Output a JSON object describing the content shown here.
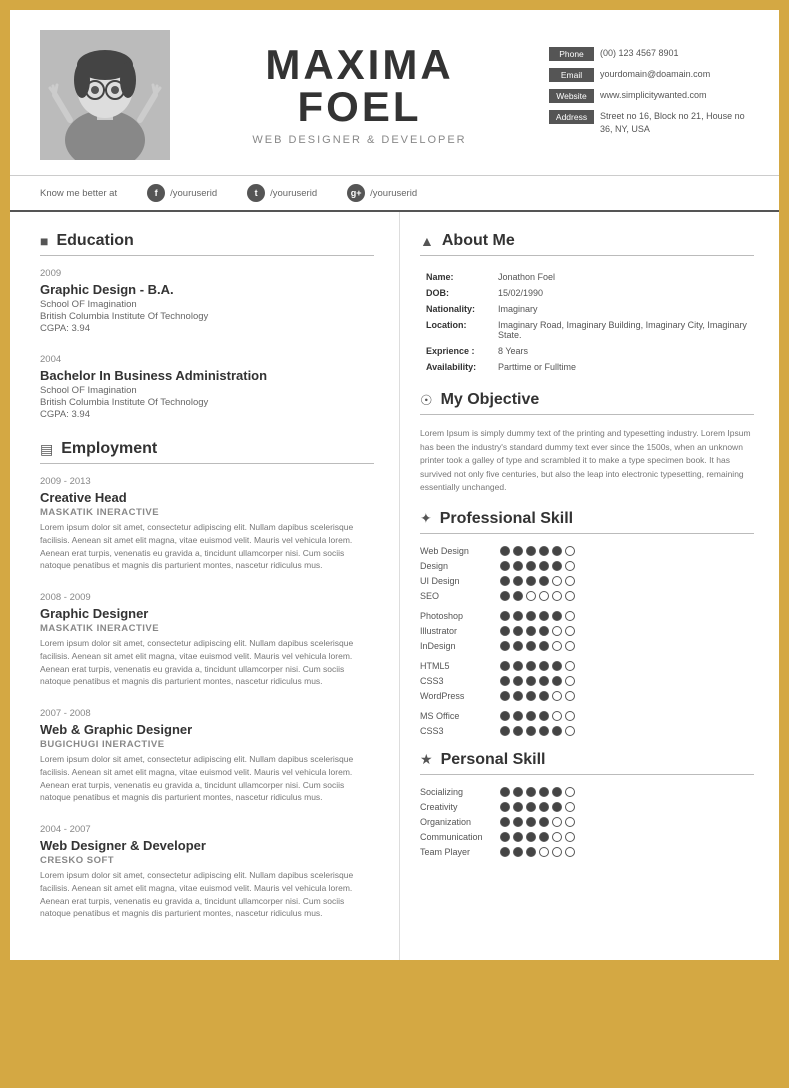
{
  "header": {
    "photo_alt": "Maxima Foel photo",
    "first_name": "MAXIMA",
    "last_name": "FOEL",
    "title": "WEB DESIGNER & DEVELOPER",
    "contact": {
      "phone_label": "Phone",
      "phone": "(00) 123 4567 8901",
      "email_label": "Email",
      "email": "yourdomain@doamain.com",
      "website_label": "Website",
      "website": "www.simplicitywanted.com",
      "address_label": "Address",
      "address": "Street no 16, Block no 21, House no 36, NY, USA"
    }
  },
  "social": {
    "know_me": "Know me better at",
    "facebook": "/youruserid",
    "twitter": "/youruserid",
    "gplus": "/youruserid"
  },
  "education": {
    "section_title": "Education",
    "items": [
      {
        "year": "2009",
        "title": "Graphic Design - B.A.",
        "school": "School OF Imagination",
        "university": "British Columbia  Institute Of Technology",
        "cgpa": "CGPA:  3.94"
      },
      {
        "year": "2004",
        "title": "Bachelor In Business Administration",
        "school": "School OF Imagination",
        "university": "British Columbia  Institute Of Technology",
        "cgpa": "CGPA:  3.94"
      }
    ]
  },
  "employment": {
    "section_title": "Employment",
    "items": [
      {
        "year": "2009 - 2013",
        "title": "Creative Head",
        "company": "MASKATIK INERACTIVE",
        "text": "Lorem ipsum dolor sit amet, consectetur adipiscing elit. Nullam dapibus scelerisque facilisis. Aenean sit amet elit magna, vitae euismod velit. Mauris vel vehicula lorem. Aenean erat turpis, venenatis eu gravida a, tincidunt ullamcorper nisi. Cum sociis natoque penatibus et magnis dis parturient montes, nascetur ridiculus mus."
      },
      {
        "year": "2008 - 2009",
        "title": "Graphic Designer",
        "company": "MASKATIK INERACTIVE",
        "text": "Lorem ipsum dolor sit amet, consectetur adipiscing elit. Nullam dapibus scelerisque facilisis. Aenean sit amet elit magna, vitae euismod velit. Mauris vel vehicula lorem. Aenean erat turpis, venenatis eu gravida a, tincidunt ullamcorper nisi. Cum sociis natoque penatibus et magnis dis parturient montes, nascetur ridiculus mus."
      },
      {
        "year": "2007 - 2008",
        "title": "Web & Graphic Designer",
        "company": "BUGICHUGI INERACTIVE",
        "text": "Lorem ipsum dolor sit amet, consectetur adipiscing elit. Nullam dapibus scelerisque facilisis. Aenean sit amet elit magna, vitae euismod velit. Mauris vel vehicula lorem. Aenean erat turpis, venenatis eu gravida a, tincidunt ullamcorper nisi. Cum sociis natoque penatibus et magnis dis parturient montes, nascetur ridiculus mus."
      },
      {
        "year": "2004 - 2007",
        "title": "Web Designer & Developer",
        "company": "CRESKO SOFT",
        "text": "Lorem ipsum dolor sit amet, consectetur adipiscing elit. Nullam dapibus scelerisque facilisis. Aenean sit amet elit magna, vitae euismod velit. Mauris vel vehicula lorem. Aenean erat turpis, venenatis eu gravida a, tincidunt ullamcorper nisi. Cum sociis natoque penatibus et magnis dis parturient montes, nascetur ridiculus mus."
      }
    ]
  },
  "about": {
    "section_title": "About Me",
    "name_label": "Name:",
    "name_value": "Jonathon Foel",
    "dob_label": "DOB:",
    "dob_value": "15/02/1990",
    "nationality_label": "Nationality:",
    "nationality_value": "Imaginary",
    "location_label": "Location:",
    "location_value": "Imaginary Road, Imaginary Building, Imaginary City, Imaginary State.",
    "experience_label": "Exprience :",
    "experience_value": "8 Years",
    "availability_label": "Availability:",
    "availability_value": "Parttime  or  Fulltime"
  },
  "objective": {
    "section_title": "My Objective",
    "text": "Lorem Ipsum is simply dummy text of the printing and typesetting industry. Lorem Ipsum has been the industry's standard dummy text ever since the 1500s, when an unknown printer took a galley of type and scrambled it to make a type specimen book. It has survived not only five centuries, but also the leap into electronic typesetting, remaining essentially unchanged."
  },
  "professional_skill": {
    "section_title": "Professional Skill",
    "groups": [
      {
        "skills": [
          {
            "name": "Web Design",
            "filled": 5,
            "total": 6
          },
          {
            "name": "Design",
            "filled": 5,
            "total": 6
          },
          {
            "name": "UI Design",
            "filled": 4,
            "total": 6
          },
          {
            "name": "SEO",
            "filled": 2,
            "total": 6
          }
        ]
      },
      {
        "skills": [
          {
            "name": "Photoshop",
            "filled": 5,
            "total": 6
          },
          {
            "name": "Illustrator",
            "filled": 4,
            "total": 6
          },
          {
            "name": "InDesign",
            "filled": 4,
            "total": 6
          }
        ]
      },
      {
        "skills": [
          {
            "name": "HTML5",
            "filled": 5,
            "total": 6
          },
          {
            "name": "CSS3",
            "filled": 5,
            "total": 6
          },
          {
            "name": "WordPress",
            "filled": 4,
            "total": 6
          }
        ]
      },
      {
        "skills": [
          {
            "name": "MS Office",
            "filled": 4,
            "total": 6
          },
          {
            "name": "CSS3",
            "filled": 5,
            "total": 6
          }
        ]
      }
    ]
  },
  "personal_skill": {
    "section_title": "Personal Skill",
    "skills": [
      {
        "name": "Socializing",
        "filled": 5,
        "total": 6
      },
      {
        "name": "Creativity",
        "filled": 5,
        "total": 6
      },
      {
        "name": "Organization",
        "filled": 4,
        "total": 6
      },
      {
        "name": "Communication",
        "filled": 4,
        "total": 6
      },
      {
        "name": "Team Player",
        "filled": 3,
        "total": 6
      }
    ]
  }
}
